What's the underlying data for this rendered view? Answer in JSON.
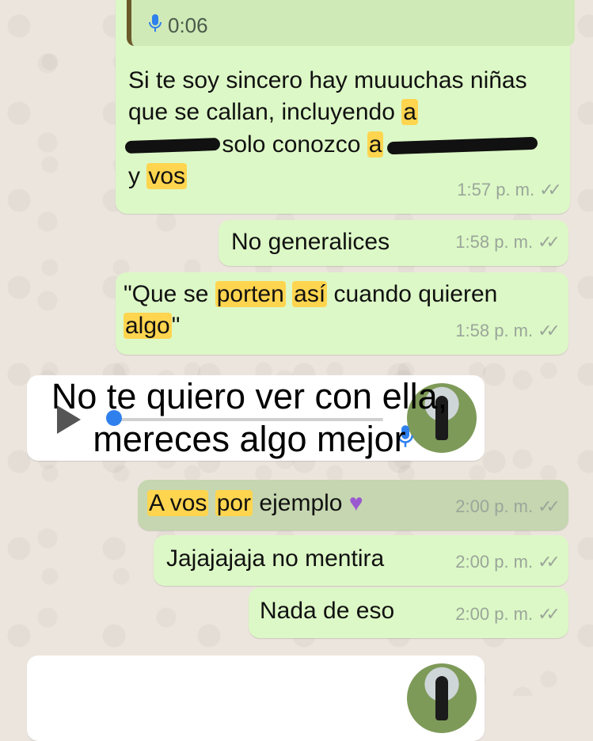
{
  "quoted": {
    "duration": "0:06"
  },
  "msg1": {
    "part1": "Si te soy sincero hay muuuchas niñas que se callan, incluyendo",
    "hl1": "a",
    "part2": "solo conozco",
    "hl2": "a",
    "part3": "y",
    "hl3": "vos",
    "time": "1:57 p. m."
  },
  "msg2": {
    "text": "No generalices",
    "time": "1:58 p. m."
  },
  "msg3": {
    "part1": "\"Que se",
    "hl1": "porten",
    "hl2": "así",
    "part2": "cuando quieren",
    "hl3": "algo",
    "part3": "\"",
    "time": "1:58 p. m."
  },
  "caption": {
    "line1": "No te quiero ver con ella,",
    "line2": "mereces algo mejor"
  },
  "msg4": {
    "hl1": "A vos",
    "hl2": "por",
    "part1": " ejemplo",
    "time": "2:00 p. m."
  },
  "msg5": {
    "text": "Jajajajaja no mentira",
    "time": "2:00 p. m."
  },
  "msg6": {
    "text": "Nada de eso",
    "time": "2:00 p. m."
  },
  "colors": {
    "outgoing_bubble": "#dcf8c6",
    "incoming_bubble": "#ffffff",
    "highlight": "#ffd54f",
    "accent_blue": "#2f80ed"
  }
}
